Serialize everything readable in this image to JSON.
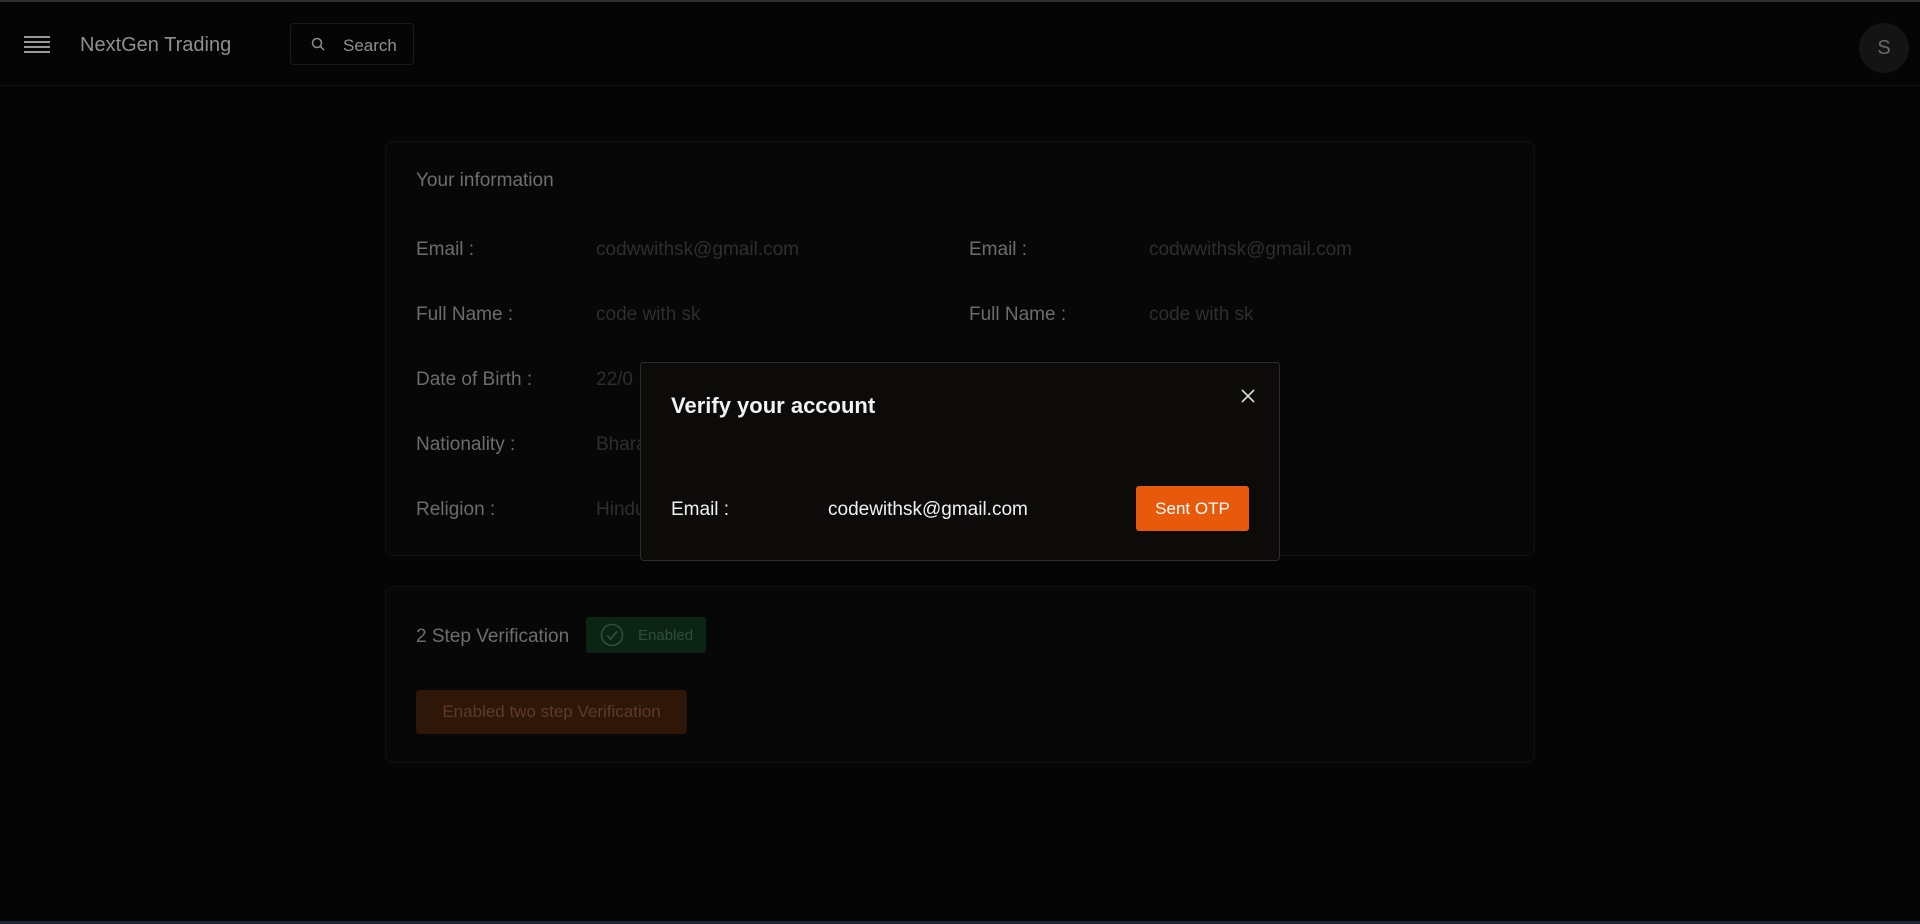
{
  "header": {
    "brand": "NextGen Trading",
    "search_label": "Search",
    "avatar_initial": "S"
  },
  "info": {
    "title": "Your information",
    "left_rows": [
      {
        "label": "Email :",
        "value": "codwwithsk@gmail.com"
      },
      {
        "label": "Full Name :",
        "value": "code with sk"
      },
      {
        "label": "Date of Birth :",
        "value": "22/0"
      },
      {
        "label": "Nationality :",
        "value": "Bhara"
      },
      {
        "label": "Religion :",
        "value": "Hindu"
      }
    ],
    "right_rows": [
      {
        "label": "Email :",
        "value": "codwwithsk@gmail.com"
      },
      {
        "label": "Full Name :",
        "value": "code with sk"
      }
    ]
  },
  "two_step": {
    "title": "2 Step Verification",
    "badge_label": "Enabled",
    "button_label": "Enabled two step Verification"
  },
  "modal": {
    "title": "Verify your account",
    "email_label": "Email :",
    "email_value": "codewithsk@gmail.com",
    "otp_button": "Sent OTP"
  },
  "colors": {
    "accent": "#e8590c",
    "badge_bg": "#0c2414",
    "background": "#050505"
  },
  "icons": [
    "menu-icon",
    "search-icon",
    "check-badge-icon",
    "close-icon"
  ]
}
